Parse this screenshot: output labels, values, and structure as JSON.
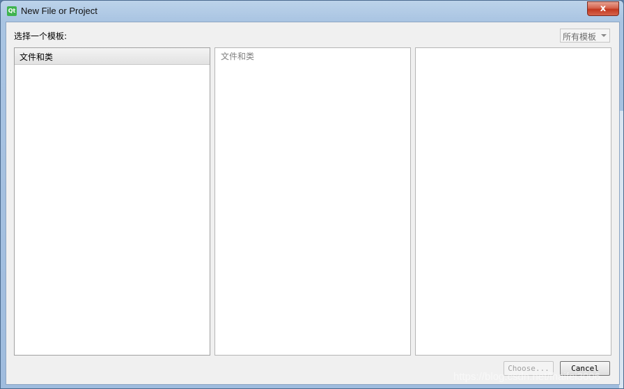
{
  "window": {
    "title": "New File or Project",
    "icon_text": "Qt",
    "close_label": "x"
  },
  "prompt_label": "选择一个模板:",
  "filter": {
    "selected": "所有模板"
  },
  "categories": [
    {
      "label": "文件和类"
    }
  ],
  "subcategory_label": "文件和类",
  "buttons": {
    "choose": "Choose...",
    "cancel": "Cancel"
  },
  "watermark": "https://blog.csdn.net/lhaifei3006"
}
